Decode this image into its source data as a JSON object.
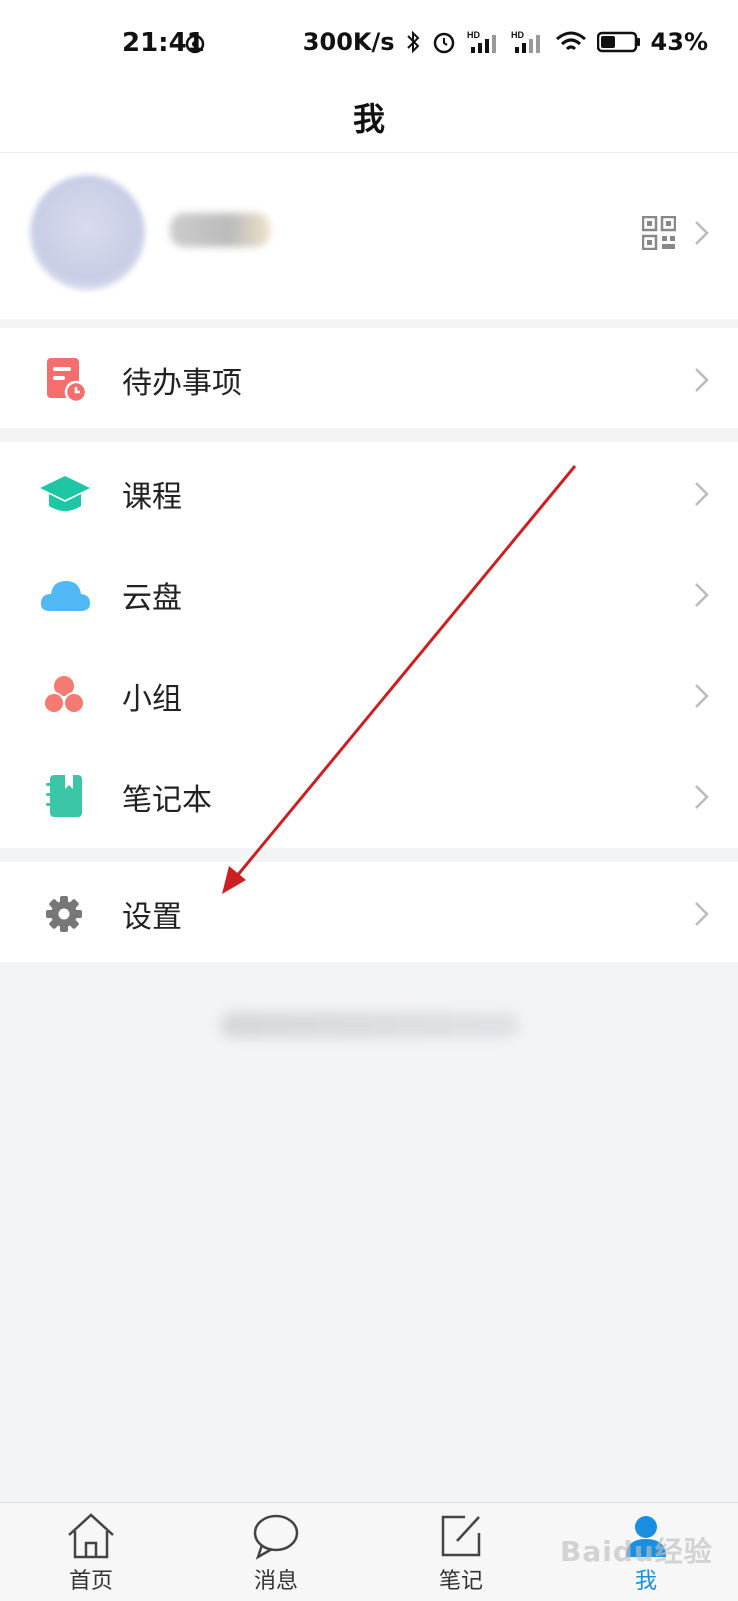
{
  "status_bar": {
    "time": "21:41",
    "speed": "300K/s",
    "battery": "43%",
    "battery_level": 0.43,
    "icons": [
      "sync-icon",
      "bluetooth-icon",
      "alarm-icon",
      "signal-hd-icon",
      "signal-hd-icon",
      "wifi-icon",
      "battery-icon"
    ]
  },
  "header": {
    "title": "我"
  },
  "profile": {
    "qr_icon": "qr-code-icon"
  },
  "menu": {
    "todo": {
      "label": "待办事项",
      "icon": "todo-icon",
      "color": "#f46e6e"
    },
    "course": {
      "label": "课程",
      "icon": "graduation-cap-icon",
      "color": "#1ec7a4"
    },
    "cloud": {
      "label": "云盘",
      "icon": "cloud-icon",
      "color": "#4fb8f5"
    },
    "group": {
      "label": "小组",
      "icon": "group-icon",
      "color": "#f47a72"
    },
    "notebook": {
      "label": "笔记本",
      "icon": "notebook-icon",
      "color": "#3cc6a8"
    },
    "settings": {
      "label": "设置",
      "icon": "gear-icon",
      "color": "#777777"
    }
  },
  "tabs": [
    {
      "label": "首页",
      "icon": "home-icon"
    },
    {
      "label": "消息",
      "icon": "message-icon"
    },
    {
      "label": "笔记",
      "icon": "edit-note-icon"
    },
    {
      "label": "我",
      "icon": "user-icon",
      "active": true
    }
  ],
  "watermark": "Baidu经验",
  "accent_color": "#1a8fe0",
  "annotation_color": "#cc1f1f"
}
